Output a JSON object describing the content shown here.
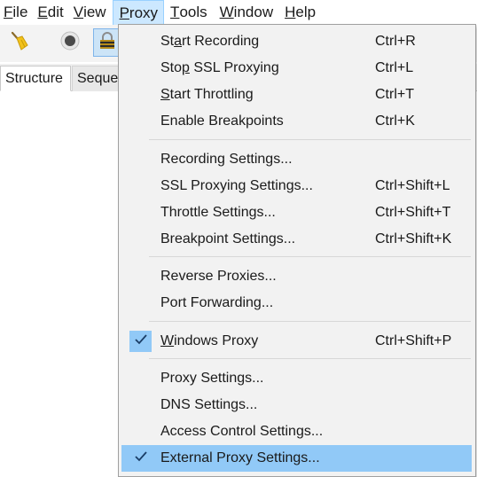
{
  "menubar": {
    "file": {
      "mnemonic": "F",
      "rest": "ile"
    },
    "edit": {
      "mnemonic": "E",
      "rest": "dit"
    },
    "view": {
      "mnemonic": "V",
      "rest": "iew"
    },
    "proxy": {
      "mnemonic": "P",
      "rest": "roxy"
    },
    "tools": {
      "mnemonic": "T",
      "rest": "ools"
    },
    "window": {
      "mnemonic": "W",
      "rest": "indow"
    },
    "help": {
      "mnemonic": "H",
      "rest": "elp"
    }
  },
  "tabs": {
    "structure": "Structure",
    "sequence": "Seque"
  },
  "proxy_menu": {
    "start_recording": {
      "pre": "St",
      "mnemonic": "a",
      "post": "rt Recording",
      "shortcut": "Ctrl+R"
    },
    "stop_ssl": {
      "pre": "Sto",
      "mnemonic": "p",
      "post": " SSL Proxying",
      "shortcut": "Ctrl+L"
    },
    "start_throttling": {
      "pre": "",
      "mnemonic": "S",
      "post": "tart Throttling",
      "shortcut": "Ctrl+T"
    },
    "enable_breakpoints": {
      "label": "Enable Breakpoints",
      "shortcut": "Ctrl+K"
    },
    "recording_settings": {
      "label": "Recording Settings..."
    },
    "ssl_settings": {
      "label": "SSL Proxying Settings...",
      "shortcut": "Ctrl+Shift+L"
    },
    "throttle_settings": {
      "label": "Throttle Settings...",
      "shortcut": "Ctrl+Shift+T"
    },
    "breakpoint_settings": {
      "label": "Breakpoint Settings...",
      "shortcut": "Ctrl+Shift+K"
    },
    "reverse_proxies": {
      "label": "Reverse Proxies..."
    },
    "port_forwarding": {
      "label": "Port Forwarding..."
    },
    "windows_proxy": {
      "pre": "",
      "mnemonic": "W",
      "post": "indows Proxy",
      "shortcut": "Ctrl+Shift+P",
      "checked": true
    },
    "proxy_settings": {
      "label": "Proxy Settings..."
    },
    "dns_settings": {
      "label": "DNS Settings..."
    },
    "access_control": {
      "label": "Access Control Settings..."
    },
    "external_proxy": {
      "label": "External Proxy Settings...",
      "checked": true,
      "highlighted": true
    }
  },
  "icons": {
    "broom": "broom-icon",
    "record": "record-icon",
    "lock": "lock-icon",
    "check": "check-icon"
  },
  "colors": {
    "menu_highlight": "#91c9f7",
    "menubar_active": "#cce8ff",
    "menu_bg": "#f2f2f2"
  }
}
